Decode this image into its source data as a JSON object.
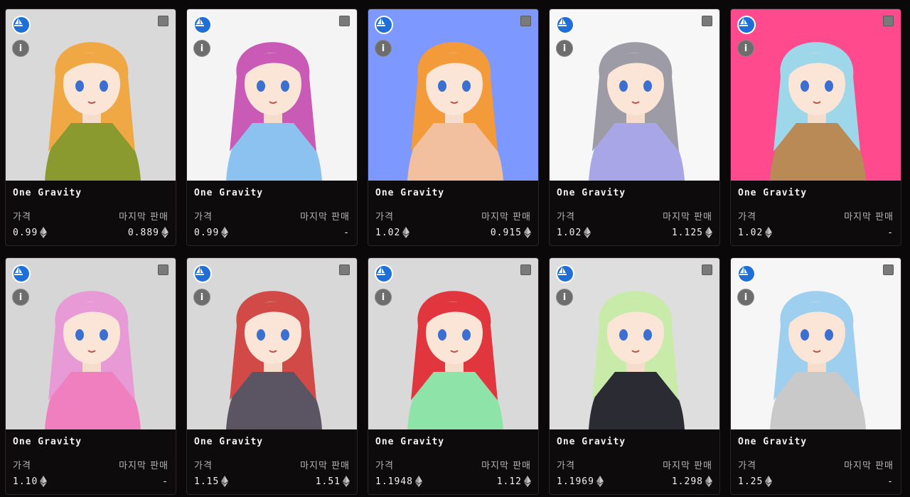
{
  "labels": {
    "price": "가격",
    "last_sale": "마지막 판매"
  },
  "cards": [
    {
      "name": "One Gravity",
      "price": "0.99",
      "last_sale": "0.889",
      "bg": "#d9d9d9",
      "hair": "#f0a845",
      "outfit": "#8a9a2e"
    },
    {
      "name": "One Gravity",
      "price": "0.99",
      "last_sale": "-",
      "bg": "#f4f4f4",
      "hair": "#c95ab5",
      "outfit": "#8cc2ef"
    },
    {
      "name": "One Gravity",
      "price": "1.02",
      "last_sale": "0.915",
      "bg": "#7d98fe",
      "hair": "#f39a3b",
      "outfit": "#f3c09f"
    },
    {
      "name": "One Gravity",
      "price": "1.02",
      "last_sale": "1.125",
      "bg": "#f7f7f7",
      "hair": "#9d9ba6",
      "outfit": "#a9a6e8"
    },
    {
      "name": "One Gravity",
      "price": "1.02",
      "last_sale": "-",
      "bg": "#ff4a8d",
      "hair": "#9ed6ea",
      "outfit": "#b98a55"
    },
    {
      "name": "One Gravity",
      "price": "1.10",
      "last_sale": "-",
      "bg": "#d6d6d6",
      "hair": "#e79ad6",
      "outfit": "#ef7fbf"
    },
    {
      "name": "One Gravity",
      "price": "1.15",
      "last_sale": "1.51",
      "bg": "#d8d8d8",
      "hair": "#d14a48",
      "outfit": "#5a5463"
    },
    {
      "name": "One Gravity",
      "price": "1.1948",
      "last_sale": "1.12",
      "bg": "#d9d9d9",
      "hair": "#e2363e",
      "outfit": "#8ee3a8"
    },
    {
      "name": "One Gravity",
      "price": "1.1969",
      "last_sale": "1.298",
      "bg": "#dedede",
      "hair": "#c9ebaa",
      "outfit": "#2b2b33"
    },
    {
      "name": "One Gravity",
      "price": "1.25",
      "last_sale": "-",
      "bg": "#f6f6f6",
      "hair": "#9fcfef",
      "outfit": "#c9c9c9"
    }
  ],
  "icons": {
    "marketplace": "opensea-icon",
    "info": "info-icon",
    "select": "checkbox-icon",
    "currency": "eth-icon"
  }
}
